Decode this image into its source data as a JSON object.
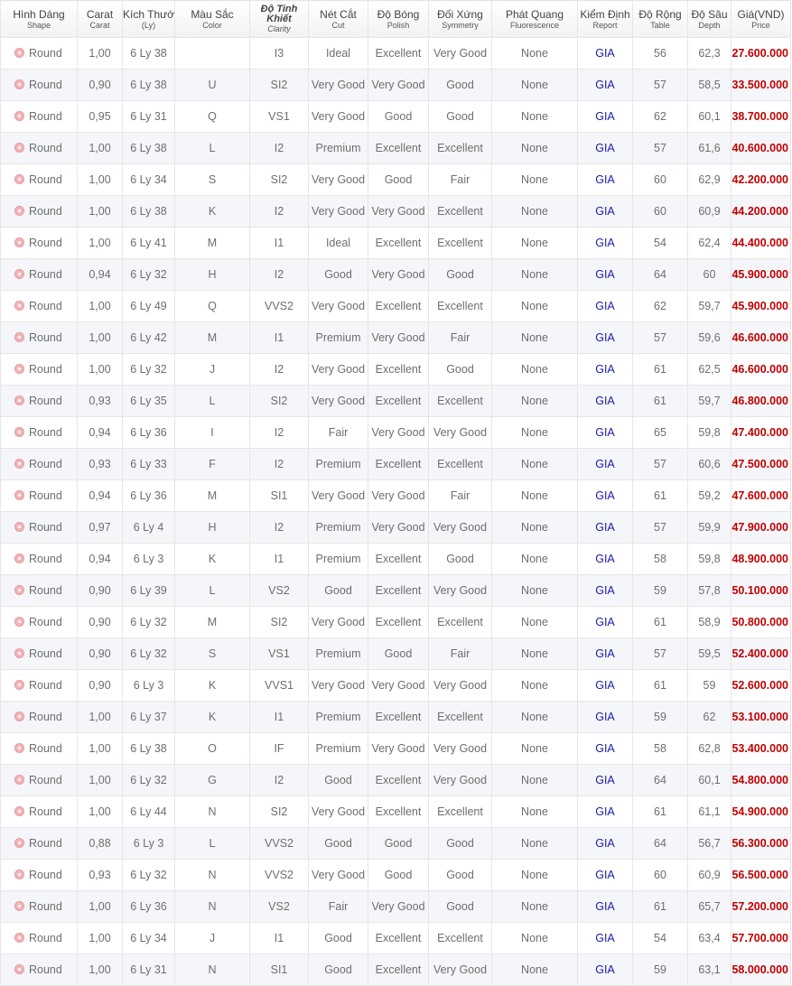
{
  "headers": [
    {
      "main": "Hình Dáng",
      "sub": "Shape"
    },
    {
      "main": "Carat",
      "sub": "Carat"
    },
    {
      "main": "Kích Thước",
      "sub": "(Ly)"
    },
    {
      "main": "Màu Sắc",
      "sub": "Color"
    },
    {
      "main": "Độ Tinh Khiết",
      "sub": "Clarity"
    },
    {
      "main": "Nét Cắt",
      "sub": "Cut"
    },
    {
      "main": "Độ Bóng",
      "sub": "Polish"
    },
    {
      "main": "Đối Xứng",
      "sub": "Symmetry"
    },
    {
      "main": "Phát Quang",
      "sub": "Fluorescence"
    },
    {
      "main": "Kiểm Định",
      "sub": "Report"
    },
    {
      "main": "Độ Rộng",
      "sub": "Table"
    },
    {
      "main": "Độ Sâu",
      "sub": "Depth"
    },
    {
      "main": "Giá(VND)",
      "sub": "Price"
    }
  ],
  "shape_icon": "diamond-round-icon",
  "colors": {
    "price": "#c00000",
    "report": "#1a1aa6",
    "row_alt": "#f5f6fa"
  },
  "rows": [
    [
      "Round",
      "1,00",
      "6 Ly 38",
      "",
      "I3",
      "Ideal",
      "Excellent",
      "Very Good",
      "None",
      "GIA",
      "56",
      "62,3",
      "27.600.000"
    ],
    [
      "Round",
      "0,90",
      "6 Ly 38",
      "U",
      "SI2",
      "Very Good",
      "Very Good",
      "Good",
      "None",
      "GIA",
      "57",
      "58,5",
      "33.500.000"
    ],
    [
      "Round",
      "0,95",
      "6 Ly 31",
      "Q",
      "VS1",
      "Very Good",
      "Good",
      "Good",
      "None",
      "GIA",
      "62",
      "60,1",
      "38.700.000"
    ],
    [
      "Round",
      "1,00",
      "6 Ly 38",
      "L",
      "I2",
      "Premium",
      "Excellent",
      "Excellent",
      "None",
      "GIA",
      "57",
      "61,6",
      "40.600.000"
    ],
    [
      "Round",
      "1,00",
      "6 Ly 34",
      "S",
      "SI2",
      "Very Good",
      "Good",
      "Fair",
      "None",
      "GIA",
      "60",
      "62,9",
      "42.200.000"
    ],
    [
      "Round",
      "1,00",
      "6 Ly 38",
      "K",
      "I2",
      "Very Good",
      "Very Good",
      "Excellent",
      "None",
      "GIA",
      "60",
      "60,9",
      "44.200.000"
    ],
    [
      "Round",
      "1,00",
      "6 Ly 41",
      "M",
      "I1",
      "Ideal",
      "Excellent",
      "Excellent",
      "None",
      "GIA",
      "54",
      "62,4",
      "44.400.000"
    ],
    [
      "Round",
      "0,94",
      "6 Ly 32",
      "H",
      "I2",
      "Good",
      "Very Good",
      "Good",
      "None",
      "GIA",
      "64",
      "60",
      "45.900.000"
    ],
    [
      "Round",
      "1,00",
      "6 Ly 49",
      "Q",
      "VVS2",
      "Very Good",
      "Excellent",
      "Excellent",
      "None",
      "GIA",
      "62",
      "59,7",
      "45.900.000"
    ],
    [
      "Round",
      "1,00",
      "6 Ly 42",
      "M",
      "I1",
      "Premium",
      "Very Good",
      "Fair",
      "None",
      "GIA",
      "57",
      "59,6",
      "46.600.000"
    ],
    [
      "Round",
      "1,00",
      "6 Ly 32",
      "J",
      "I2",
      "Very Good",
      "Excellent",
      "Good",
      "None",
      "GIA",
      "61",
      "62,5",
      "46.600.000"
    ],
    [
      "Round",
      "0,93",
      "6 Ly 35",
      "L",
      "SI2",
      "Very Good",
      "Excellent",
      "Excellent",
      "None",
      "GIA",
      "61",
      "59,7",
      "46.800.000"
    ],
    [
      "Round",
      "0,94",
      "6 Ly 36",
      "I",
      "I2",
      "Fair",
      "Very Good",
      "Very Good",
      "None",
      "GIA",
      "65",
      "59,8",
      "47.400.000"
    ],
    [
      "Round",
      "0,93",
      "6 Ly 33",
      "F",
      "I2",
      "Premium",
      "Excellent",
      "Excellent",
      "None",
      "GIA",
      "57",
      "60,6",
      "47.500.000"
    ],
    [
      "Round",
      "0,94",
      "6 Ly 36",
      "M",
      "SI1",
      "Very Good",
      "Very Good",
      "Fair",
      "None",
      "GIA",
      "61",
      "59,2",
      "47.600.000"
    ],
    [
      "Round",
      "0,97",
      "6 Ly 4",
      "H",
      "I2",
      "Premium",
      "Very Good",
      "Very Good",
      "None",
      "GIA",
      "57",
      "59,9",
      "47.900.000"
    ],
    [
      "Round",
      "0,94",
      "6 Ly 3",
      "K",
      "I1",
      "Premium",
      "Excellent",
      "Good",
      "None",
      "GIA",
      "58",
      "59,8",
      "48.900.000"
    ],
    [
      "Round",
      "0,90",
      "6 Ly 39",
      "L",
      "VS2",
      "Good",
      "Excellent",
      "Very Good",
      "None",
      "GIA",
      "59",
      "57,8",
      "50.100.000"
    ],
    [
      "Round",
      "0,90",
      "6 Ly 32",
      "M",
      "SI2",
      "Very Good",
      "Excellent",
      "Excellent",
      "None",
      "GIA",
      "61",
      "58,9",
      "50.800.000"
    ],
    [
      "Round",
      "0,90",
      "6 Ly 32",
      "S",
      "VS1",
      "Premium",
      "Good",
      "Fair",
      "None",
      "GIA",
      "57",
      "59,5",
      "52.400.000"
    ],
    [
      "Round",
      "0,90",
      "6 Ly 3",
      "K",
      "VVS1",
      "Very Good",
      "Very Good",
      "Very Good",
      "None",
      "GIA",
      "61",
      "59",
      "52.600.000"
    ],
    [
      "Round",
      "1,00",
      "6 Ly 37",
      "K",
      "I1",
      "Premium",
      "Excellent",
      "Excellent",
      "None",
      "GIA",
      "59",
      "62",
      "53.100.000"
    ],
    [
      "Round",
      "1,00",
      "6 Ly 38",
      "O",
      "IF",
      "Premium",
      "Very Good",
      "Very Good",
      "None",
      "GIA",
      "58",
      "62,8",
      "53.400.000"
    ],
    [
      "Round",
      "1,00",
      "6 Ly 32",
      "G",
      "I2",
      "Good",
      "Excellent",
      "Very Good",
      "None",
      "GIA",
      "64",
      "60,1",
      "54.800.000"
    ],
    [
      "Round",
      "1,00",
      "6 Ly 44",
      "N",
      "SI2",
      "Very Good",
      "Excellent",
      "Excellent",
      "None",
      "GIA",
      "61",
      "61,1",
      "54.900.000"
    ],
    [
      "Round",
      "0,88",
      "6 Ly 3",
      "L",
      "VVS2",
      "Good",
      "Good",
      "Good",
      "None",
      "GIA",
      "64",
      "56,7",
      "56.300.000"
    ],
    [
      "Round",
      "0,93",
      "6 Ly 32",
      "N",
      "VVS2",
      "Very Good",
      "Good",
      "Good",
      "None",
      "GIA",
      "60",
      "60,9",
      "56.500.000"
    ],
    [
      "Round",
      "1,00",
      "6 Ly 36",
      "N",
      "VS2",
      "Fair",
      "Very Good",
      "Good",
      "None",
      "GIA",
      "61",
      "65,7",
      "57.200.000"
    ],
    [
      "Round",
      "1,00",
      "6 Ly 34",
      "J",
      "I1",
      "Good",
      "Excellent",
      "Excellent",
      "None",
      "GIA",
      "54",
      "63,4",
      "57.700.000"
    ],
    [
      "Round",
      "1,00",
      "6 Ly 31",
      "N",
      "SI1",
      "Good",
      "Excellent",
      "Very Good",
      "None",
      "GIA",
      "59",
      "63,1",
      "58.000.000"
    ]
  ]
}
